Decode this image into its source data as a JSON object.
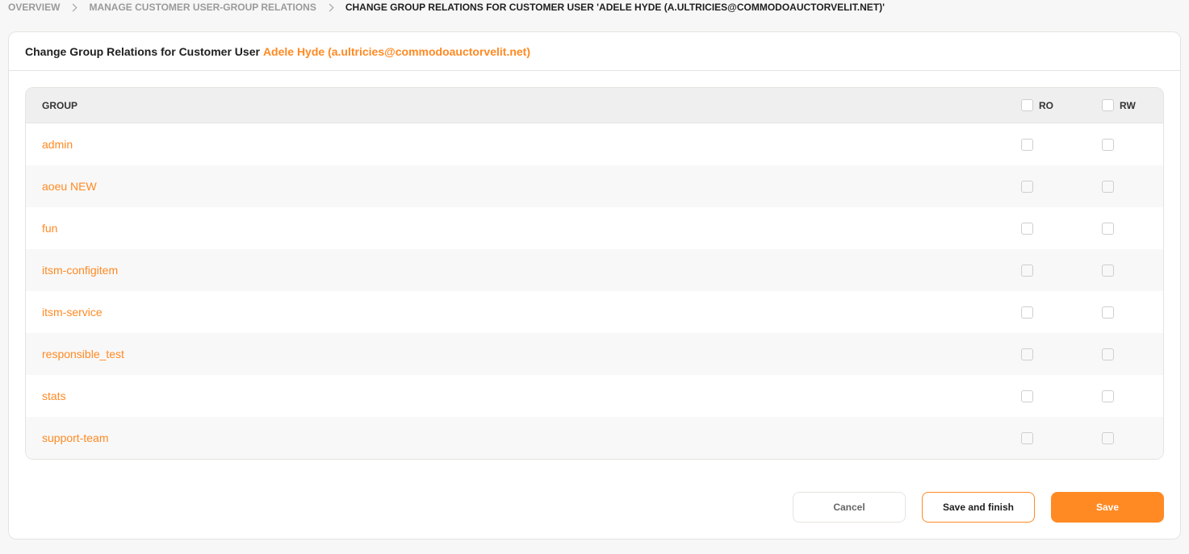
{
  "breadcrumb": {
    "items": [
      {
        "label": "Overview"
      },
      {
        "label": "Manage Customer User-Group Relations"
      }
    ],
    "current": "Change Group Relations for Customer User 'Adele Hyde (a.ultricies@commodoauctorvelit.net)'"
  },
  "panel": {
    "title_prefix": "Change Group Relations for Customer User",
    "title_user": "Adele Hyde (a.ultricies@commodoauctorvelit.net)"
  },
  "table": {
    "columns": {
      "group": "GROUP",
      "ro": "RO",
      "rw": "RW"
    },
    "header_checkboxes": {
      "ro": false,
      "rw": false
    },
    "rows": [
      {
        "name": "admin",
        "ro": false,
        "rw": false
      },
      {
        "name": "aoeu NEW",
        "ro": false,
        "rw": false
      },
      {
        "name": "fun",
        "ro": false,
        "rw": false
      },
      {
        "name": "itsm-configitem",
        "ro": false,
        "rw": false
      },
      {
        "name": "itsm-service",
        "ro": false,
        "rw": false
      },
      {
        "name": "responsible_test",
        "ro": false,
        "rw": false
      },
      {
        "name": "stats",
        "ro": false,
        "rw": false
      },
      {
        "name": "support-team",
        "ro": false,
        "rw": false
      }
    ]
  },
  "actions": {
    "cancel": "Cancel",
    "save_and_finish": "Save and finish",
    "save": "Save"
  },
  "colors": {
    "accent": "#ff8a23",
    "border": "#e6e4df",
    "background": "#f7f7f7"
  }
}
